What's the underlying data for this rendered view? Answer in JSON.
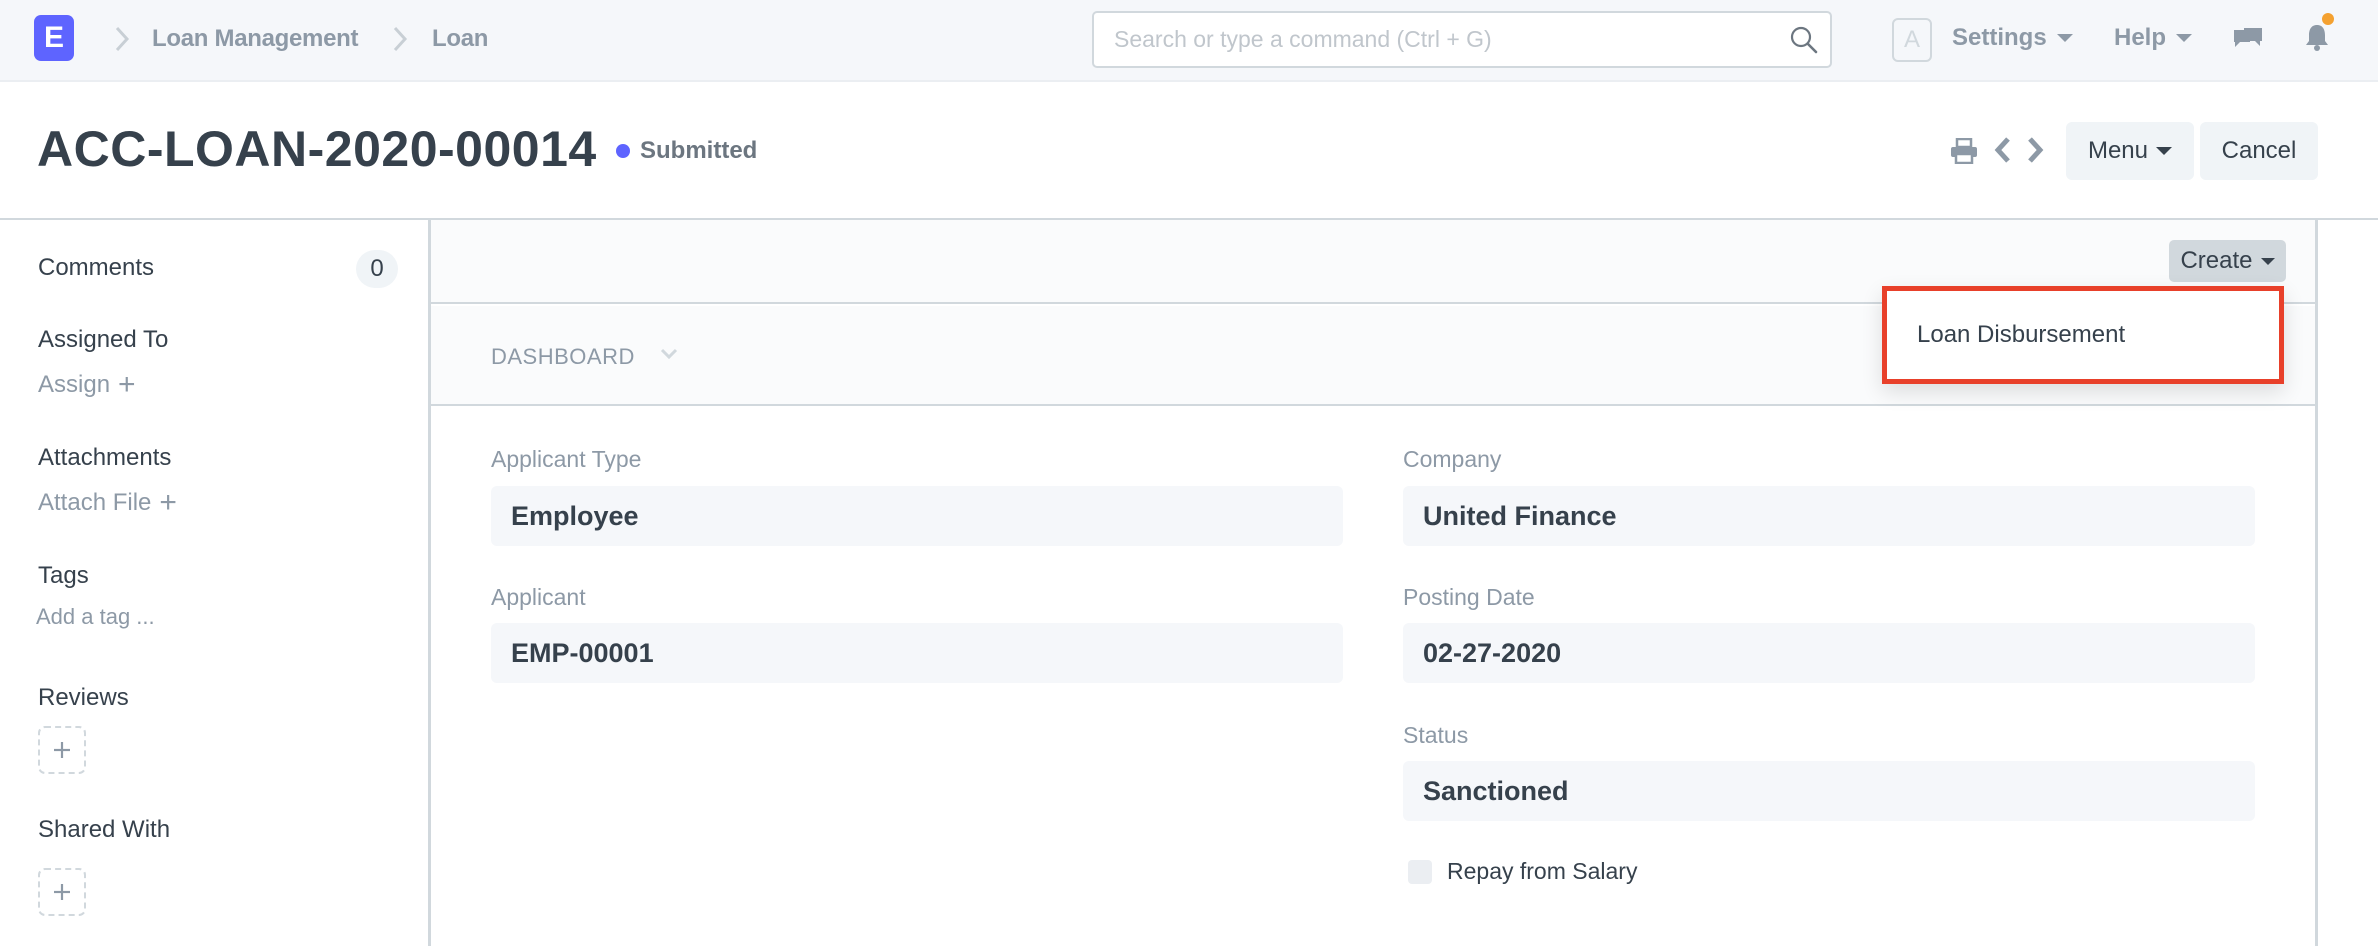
{
  "navbar": {
    "logo_letter": "E",
    "breadcrumbs": [
      "Loan Management",
      "Loan"
    ],
    "search": {
      "placeholder": "Search or type a command (Ctrl + G)",
      "value": ""
    },
    "avatar_letter": "A",
    "settings_label": "Settings",
    "help_label": "Help",
    "notification_badge_color": "#f4a130"
  },
  "page_head": {
    "title": "ACC-LOAN-2020-00014",
    "status": "Submitted",
    "status_color": "#5e64ff",
    "menu_label": "Menu",
    "cancel_label": "Cancel"
  },
  "sidebar": {
    "comments_label": "Comments",
    "comments_count": "0",
    "assigned_to_label": "Assigned To",
    "assign_link": "Assign",
    "attachments_label": "Attachments",
    "attach_file_link": "Attach File",
    "tags_label": "Tags",
    "add_tag_link": "Add a tag ...",
    "reviews_label": "Reviews",
    "shared_with_label": "Shared With"
  },
  "form": {
    "create_label": "Create",
    "create_menu_items": [
      "Loan Disbursement"
    ],
    "dashboard_label": "DASHBOARD",
    "fields": {
      "applicant_type": {
        "label": "Applicant Type",
        "value": "Employee"
      },
      "applicant": {
        "label": "Applicant",
        "value": "EMP-00001"
      },
      "company": {
        "label": "Company",
        "value": "United Finance"
      },
      "posting_date": {
        "label": "Posting Date",
        "value": "02-27-2020"
      },
      "status": {
        "label": "Status",
        "value": "Sanctioned"
      },
      "repay_from_salary": {
        "label": "Repay from Salary",
        "checked": false
      }
    }
  },
  "highlight_color": "#e8402a"
}
